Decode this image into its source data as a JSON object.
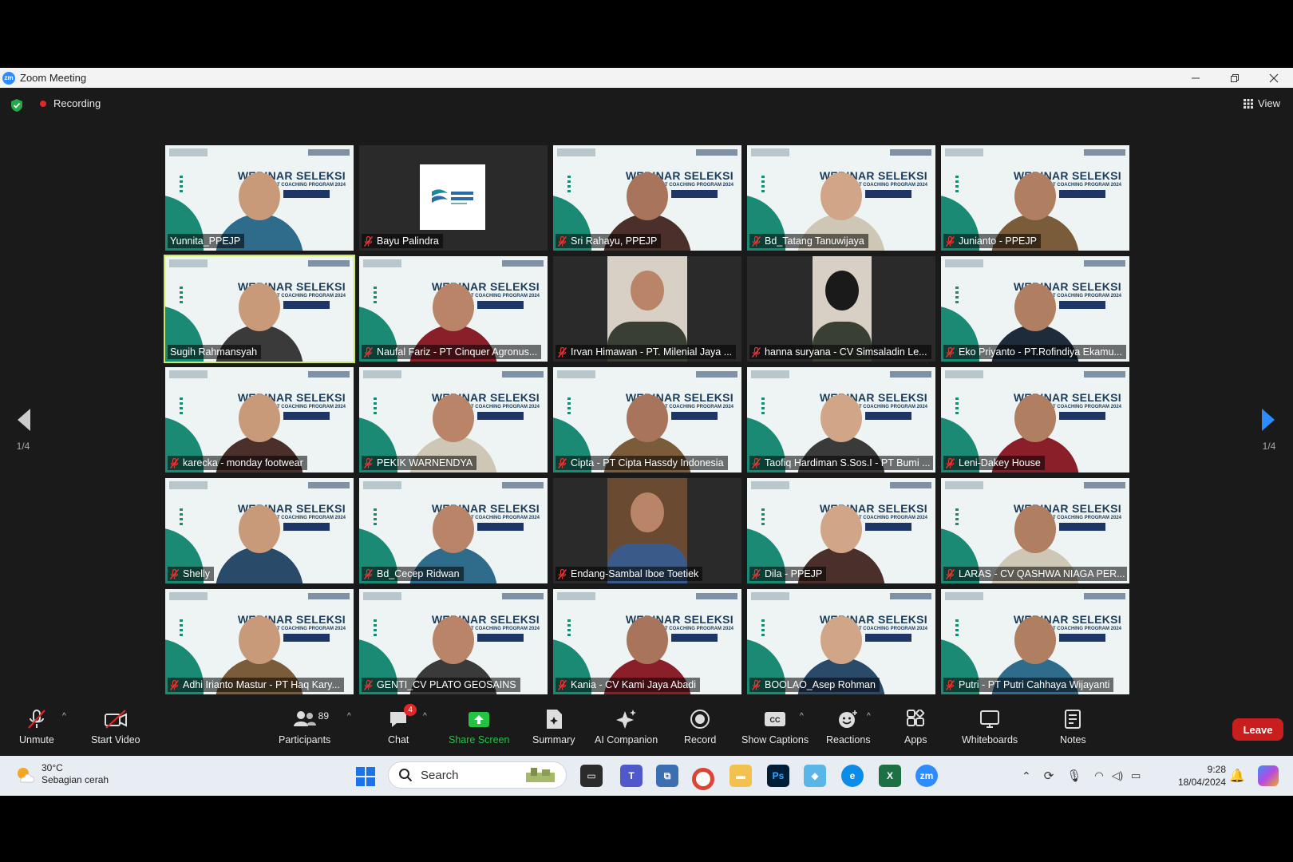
{
  "window": {
    "title": "Zoom Meeting"
  },
  "meeting": {
    "recording_label": "Recording",
    "view_label": "View",
    "page_indicator_left": "1/4",
    "page_indicator_right": "1/4"
  },
  "participants": [
    {
      "name": "Yunnita_PPEJP",
      "muted": false
    },
    {
      "name": "Bayu Palindra",
      "muted": true
    },
    {
      "name": "Sri Rahayu, PPEJP",
      "muted": true
    },
    {
      "name": "Bd_Tatang Tanuwijaya",
      "muted": true
    },
    {
      "name": "Junianto - PPEJP",
      "muted": true
    },
    {
      "name": "Sugih Rahmansyah",
      "muted": false
    },
    {
      "name": "Naufal Fariz - PT Cinquer Agronus...",
      "muted": true
    },
    {
      "name": "Irvan Himawan - PT. Milenial Jaya ...",
      "muted": true
    },
    {
      "name": "hanna suryana - CV Simsaladin Le...",
      "muted": true
    },
    {
      "name": "Eko Priyanto - PT.Rofindiya Ekamu...",
      "muted": true
    },
    {
      "name": "karecka - monday footwear",
      "muted": true
    },
    {
      "name": "PEKIK WARNENDYA",
      "muted": true
    },
    {
      "name": "Cipta - PT Cipta Hassdy Indonesia",
      "muted": true
    },
    {
      "name": "Taofiq Hardiman S.Sos.I - PT Bumi ...",
      "muted": true
    },
    {
      "name": "Leni-Dakey House",
      "muted": true
    },
    {
      "name": "Shelly",
      "muted": true
    },
    {
      "name": "Bd_Cecep Ridwan",
      "muted": true
    },
    {
      "name": "Endang-Sambal Iboe Toetiek",
      "muted": true
    },
    {
      "name": "Dila - PPEJP",
      "muted": true
    },
    {
      "name": "LARAS - CV QASHWA NIAGA PER...",
      "muted": true
    },
    {
      "name": "Adhi Irianto Mastur - PT Haq Kary...",
      "muted": true
    },
    {
      "name": "GENTI_CV PLATO GEOSAINS",
      "muted": true
    },
    {
      "name": "Kania - CV Kami Jaya Abadi",
      "muted": true
    },
    {
      "name": "BOOLAO_Asep Rohman",
      "muted": true
    },
    {
      "name": "Putri - PT Putri Cahhaya Wijayanti",
      "muted": true
    }
  ],
  "background": {
    "title": "WEBINAR SELEKSI",
    "subtitle": "EXPORT COACHING PROGRAM 2024"
  },
  "toolbar": {
    "unmute": "Unmute",
    "start_video": "Start Video",
    "participants": "Participants",
    "participants_count": "89",
    "chat": "Chat",
    "chat_badge": "4",
    "share_screen": "Share Screen",
    "summary": "Summary",
    "ai_companion": "AI Companion",
    "record": "Record",
    "show_captions": "Show Captions",
    "reactions": "Reactions",
    "apps": "Apps",
    "whiteboards": "Whiteboards",
    "notes": "Notes",
    "leave": "Leave"
  },
  "taskbar": {
    "weather_temp": "30°C",
    "weather_desc": "Sebagian cerah",
    "search_placeholder": "Search",
    "time": "9:28",
    "date": "18/04/2024"
  },
  "colors": {
    "accent_blue": "#2d8cff",
    "leave_red": "#c81e1e",
    "share_green": "#23c343",
    "active_speaker": "#c9e85a"
  }
}
